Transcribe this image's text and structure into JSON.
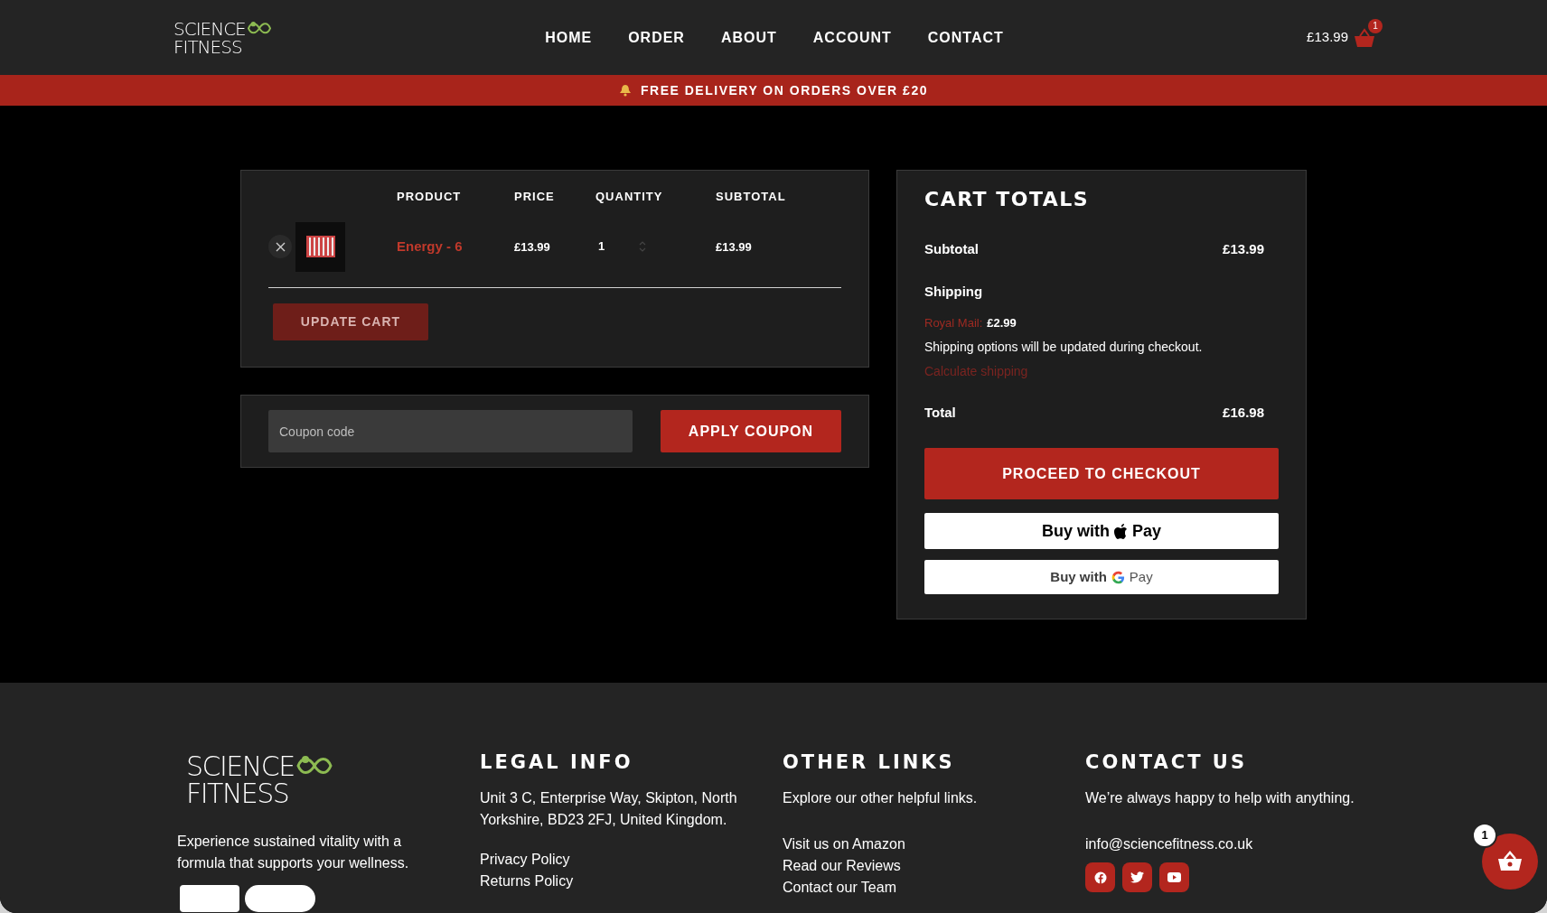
{
  "header": {
    "logo": {
      "line1": "SCIENCE",
      "line2": "FITNESS"
    },
    "nav": [
      {
        "label": "HOME"
      },
      {
        "label": "ORDER"
      },
      {
        "label": "ABOUT"
      },
      {
        "label": "ACCOUNT"
      },
      {
        "label": "CONTACT"
      }
    ],
    "cart_total": "£13.99",
    "cart_count": "1"
  },
  "banner": {
    "text": "FREE DELIVERY ON ORDERS OVER £20"
  },
  "cart_table": {
    "columns": [
      "PRODUCT",
      "PRICE",
      "QUANTITY",
      "SUBTOTAL"
    ],
    "rows": [
      {
        "product": "Energy - 6",
        "price": "£13.99",
        "quantity": "1",
        "subtotal": "£13.99"
      }
    ],
    "update_button": "UPDATE CART"
  },
  "coupon": {
    "placeholder": "Coupon code",
    "button": "APPLY COUPON"
  },
  "totals": {
    "title": "CART TOTALS",
    "subtotal_label": "Subtotal",
    "subtotal": "£13.99",
    "shipping_label": "Shipping",
    "shipping_method": "Royal Mail:",
    "shipping_price": "£2.99",
    "shipping_note": "Shipping options will be updated during checkout.",
    "calculate_link": "Calculate shipping",
    "total_label": "Total",
    "total": "£16.98",
    "checkout_button": "PROCEED TO CHECKOUT",
    "apple_pay": {
      "prefix": "Buy with",
      "suffix": "Pay"
    },
    "google_pay": {
      "prefix": "Buy with",
      "suffix": "Pay"
    }
  },
  "footer": {
    "logo": {
      "line1": "SCIENCE",
      "line2": "FITNESS"
    },
    "tagline": "Experience sustained vitality with a formula that supports your wellness.",
    "columns": [
      {
        "heading": "LEGAL INFO",
        "text": "Unit 3 C, Enterprise Way, Skipton, North Yorkshire, BD23 2FJ, United Kingdom.",
        "links": [
          "Privacy Policy",
          "Returns Policy"
        ]
      },
      {
        "heading": "OTHER LINKS",
        "text": "Explore our other helpful links.",
        "links": [
          "Visit us on Amazon",
          "Read our Reviews",
          "Contact our Team"
        ]
      },
      {
        "heading": "CONTACT US",
        "text": "We’re always happy to help with anything.",
        "links": [
          "info@sciencefitness.co.uk"
        ]
      }
    ]
  },
  "floating_cart": {
    "count": "1"
  }
}
